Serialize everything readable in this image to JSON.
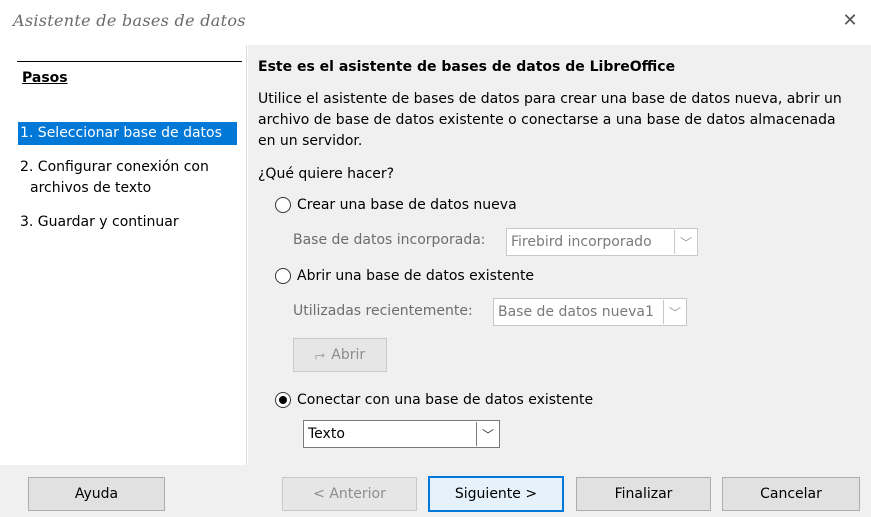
{
  "window": {
    "title": "Asistente de bases de datos"
  },
  "sidebar": {
    "title": "Pasos",
    "steps": [
      {
        "label": "1. Seleccionar base de datos"
      },
      {
        "label": "2. Configurar conexión con"
      },
      {
        "label": "archivos de texto"
      },
      {
        "label": "3. Guardar y continuar"
      }
    ]
  },
  "main": {
    "heading": "Este es el asistente de bases de datos de LibreOffice",
    "intro": "Utilice el asistente de bases de datos para crear una base de datos nueva, abrir un archivo de base de datos existente o conectarse a una base de datos almacenada en un servidor.",
    "question": "¿Qué quiere hacer?",
    "option_new": "Crear una base de datos nueva",
    "embedded_label": "Base de datos incorporada:",
    "embedded_value": "Firebird incorporado",
    "option_open": "Abrir una base de datos existente",
    "recent_label": "Utilizadas recientemente:",
    "recent_value": "Base de datos nueva1",
    "open_button": "Abrir",
    "option_connect": "Conectar con una base de datos existente",
    "connect_value": "Texto"
  },
  "footer": {
    "help": "Ayuda",
    "back": "< Anterior",
    "next": "Siguiente >",
    "finish": "Finalizar",
    "cancel": "Cancelar"
  },
  "colors": {
    "selection": "#0078d7",
    "panel": "#f0f0f0"
  }
}
